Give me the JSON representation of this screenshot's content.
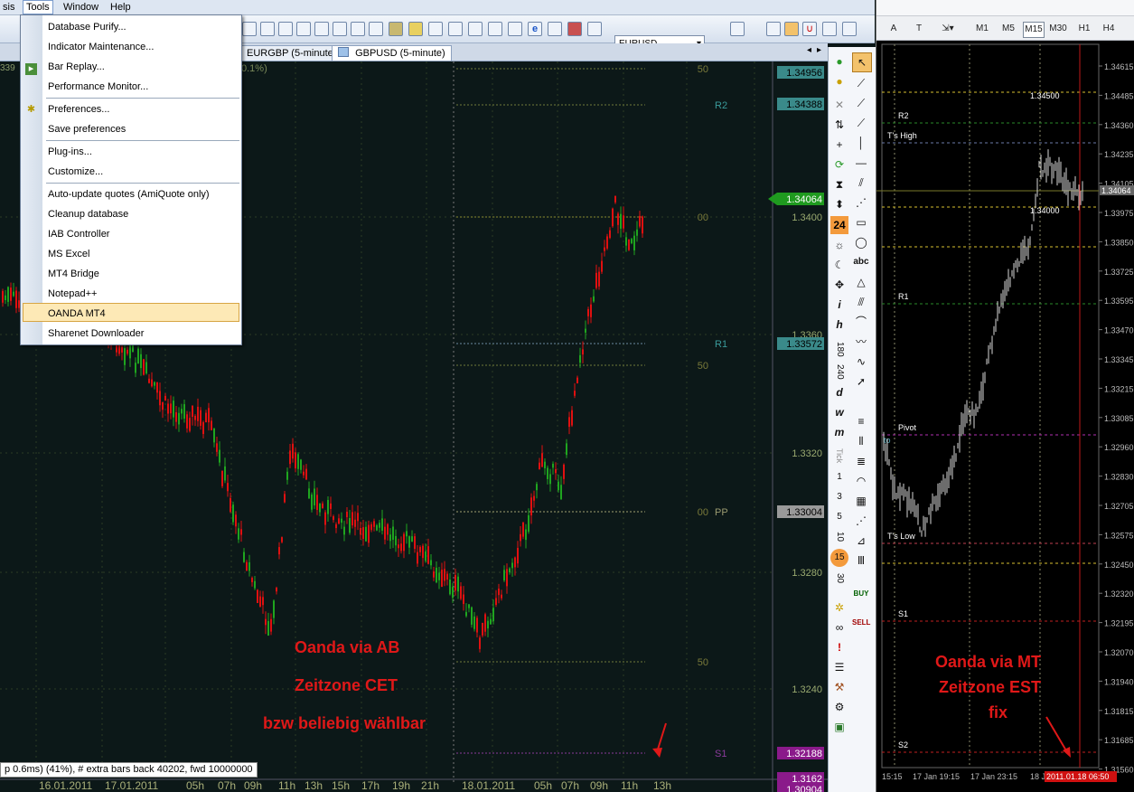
{
  "menubar": {
    "items": [
      "sis",
      "Tools",
      "Window",
      "Help"
    ],
    "active": "Tools"
  },
  "toolbar": {
    "symbol": "EURUSD"
  },
  "tabs": [
    "EURGBP (5-minute)",
    "GBPUSD (5-minute)"
  ],
  "tools_menu": {
    "items": [
      "Database Purify...",
      "Indicator Maintenance...",
      "Bar Replay...",
      "Performance Monitor...",
      "Preferences...",
      "Save preferences",
      "Plug-ins...",
      "Customize...",
      "Auto-update quotes (AmiQuote only)",
      "Cleanup database",
      "IAB Controller",
      "MS Excel",
      "MT4 Bridge",
      "Notepad++",
      "OANDA MT4",
      "Sharenet Downloader"
    ],
    "highlighted": "OANDA MT4"
  },
  "left_chart": {
    "title_fragment": "0.1%)",
    "level_labels": {
      "r2": "R2",
      "r1": "R1",
      "pp": "PP",
      "s1": "S1"
    },
    "fib_labels": [
      "50",
      "00",
      "50",
      "00",
      "50"
    ],
    "price_ticks": [
      "1.3400",
      "1.3360",
      "1.3320",
      "1.3280",
      "1.3240"
    ],
    "price_boxes": [
      "1.34956",
      "1.34388",
      "1.34064",
      "1.33572",
      "1.33004",
      "1.32188",
      "1.3162",
      "1.30904"
    ],
    "time_labels": [
      "16.01.2011",
      "17.01.2011",
      "05h",
      "07h",
      "09h",
      "11h",
      "13h",
      "15h",
      "17h",
      "19h",
      "21h",
      "18.01.2011",
      "05h",
      "07h",
      "09h",
      "11h",
      "13h"
    ],
    "annotation": [
      "Oanda via AB",
      "Zeitzone CET",
      "bzw beliebig wählbar"
    ],
    "status": "p 0.6ms) (41%), # extra bars back 40202, fwd 10000000",
    "left_edge_label": "339",
    "colors": {
      "up": "#1fa51f",
      "down": "#e01010",
      "grid": "#4a5a20"
    }
  },
  "draw_toolbar": {
    "numbers": [
      "24",
      "180",
      "240",
      "d",
      "w",
      "m",
      "Tick",
      "1",
      "3",
      "5",
      "10",
      "15",
      "30"
    ],
    "trade": [
      "BUY",
      "SELL"
    ]
  },
  "mt": {
    "toolbar_letters": [
      "A",
      "T"
    ],
    "timeframes": [
      "M1",
      "M5",
      "M15",
      "M30",
      "H1",
      "H4"
    ],
    "selected_tf": "M15",
    "levels": [
      "R2",
      "T's High",
      "R1",
      "Pivot",
      "T's Low",
      "S1",
      "S2"
    ],
    "pivot_prefix": "to",
    "round_labels": [
      "1.34500",
      "1.34000"
    ],
    "price_axis": [
      "1.34615",
      "1.34485",
      "1.34360",
      "1.34235",
      "1.34105",
      "1.33975",
      "1.33850",
      "1.33725",
      "1.33595",
      "1.33470",
      "1.33345",
      "1.33215",
      "1.33085",
      "1.32960",
      "1.32830",
      "1.32705",
      "1.32575",
      "1.32450",
      "1.32320",
      "1.32195",
      "1.32070",
      "1.31940",
      "1.31815",
      "1.31685",
      "1.31560"
    ],
    "current_price": "1.34064",
    "time_labels": [
      "15:15",
      "17 Jan 19:15",
      "17 Jan 23:15",
      "18 J"
    ],
    "time_highlight": "2011.01.18 06:50",
    "annotation": [
      "Oanda via MT",
      "Zeitzone EST",
      "fix"
    ]
  }
}
